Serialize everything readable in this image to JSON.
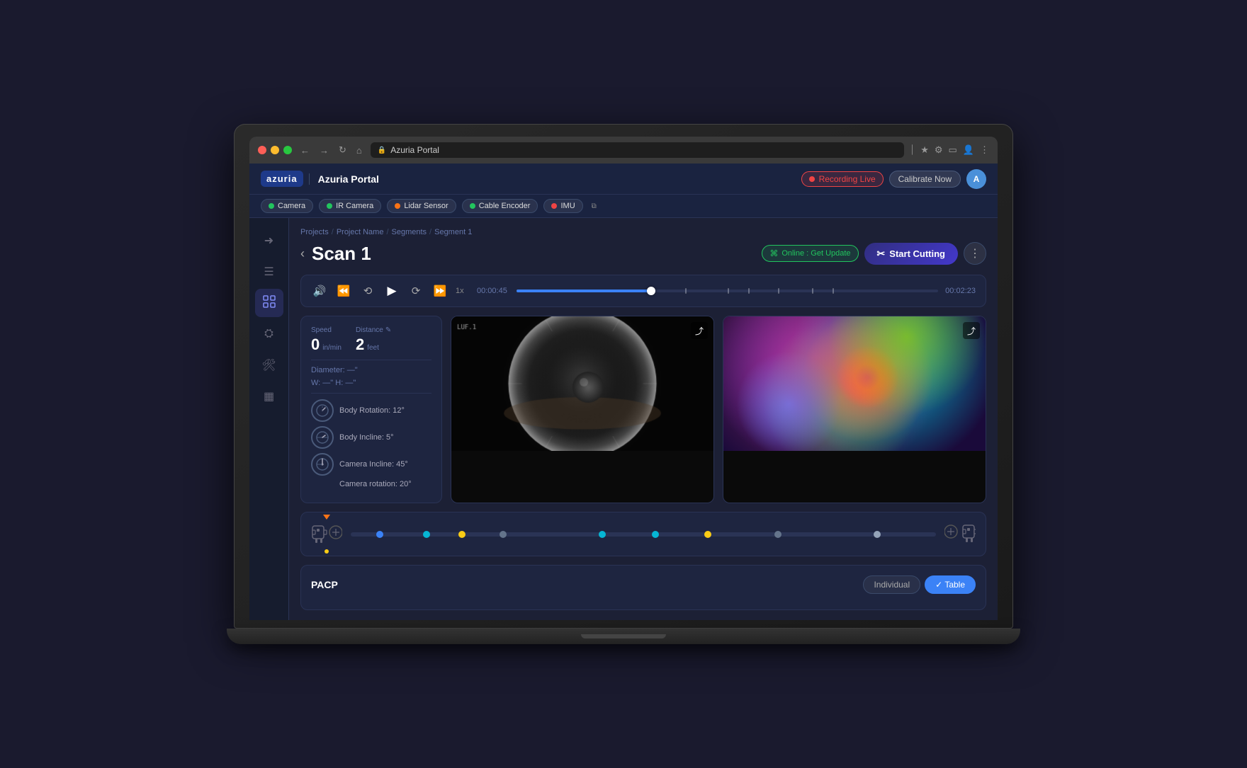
{
  "browser": {
    "address": "Azuria Portal",
    "url": "azuria-portal"
  },
  "app": {
    "title": "Azuria Portal",
    "logo_text": "azuria",
    "user_initial": "A"
  },
  "recording": {
    "label": "Recording Live",
    "calibrate_label": "Calibrate Now"
  },
  "sensors": [
    {
      "name": "Camera",
      "status": "green",
      "id": "camera"
    },
    {
      "name": "IR Camera",
      "status": "green",
      "id": "ir-camera"
    },
    {
      "name": "Lidar Sensor",
      "status": "orange",
      "id": "lidar"
    },
    {
      "name": "Cable Encoder",
      "status": "green",
      "id": "cable-encoder"
    },
    {
      "name": "IMU",
      "status": "red",
      "id": "imu"
    }
  ],
  "breadcrumb": {
    "items": [
      "Projects",
      "Project Name",
      "Segments",
      "Segment 1"
    ]
  },
  "page": {
    "title": "Scan 1",
    "back_label": "‹",
    "online_badge": "Online : Get Update",
    "start_cutting_label": "Start Cutting"
  },
  "player": {
    "current_time": "00:00:45",
    "end_time": "00:02:23",
    "speed_label": "1x",
    "progress_percent": 32
  },
  "metrics": {
    "speed_label": "Speed",
    "speed_value": "0",
    "speed_unit": "in/min",
    "distance_label": "Distance",
    "distance_value": "2",
    "distance_unit": "feet",
    "diameter_label": "Diameter: —\"",
    "dimensions_label": "W: —\"  H: —\"",
    "body_rotation_label": "Body Rotation: 12°",
    "body_incline_label": "Body Incline: 5°",
    "camera_incline_label": "Camera Incline: 45°",
    "camera_rotation_label": "Camera rotation: 20°"
  },
  "timeline": {
    "dots": [
      {
        "color": "#3b82f6",
        "pos": 5
      },
      {
        "color": "#06b6d4",
        "pos": 13
      },
      {
        "color": "#facc15",
        "pos": 19
      },
      {
        "color": "#64748b",
        "pos": 26
      },
      {
        "color": "#06b6d4",
        "pos": 43
      },
      {
        "color": "#06b6d4",
        "pos": 52
      },
      {
        "color": "#facc15",
        "pos": 61
      },
      {
        "color": "#64748b",
        "pos": 73
      },
      {
        "color": "#94a3b8",
        "pos": 90
      }
    ]
  },
  "pacp": {
    "title": "PACP",
    "individual_label": "Individual",
    "table_label": "Table",
    "active_view": "table"
  }
}
